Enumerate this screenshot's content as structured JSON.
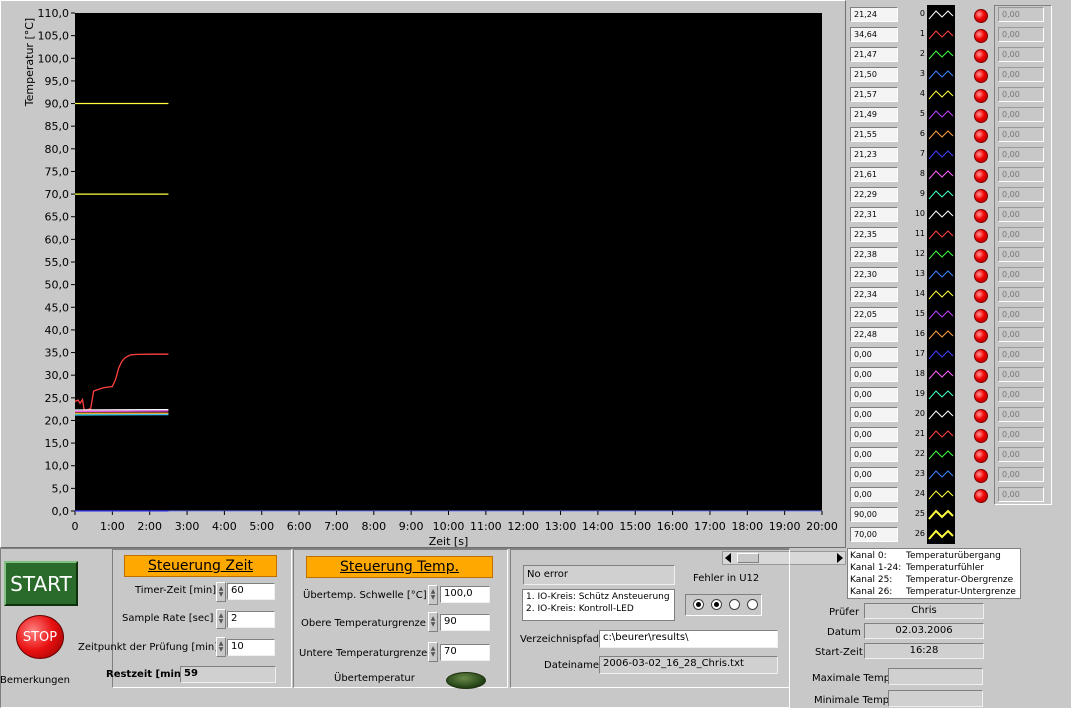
{
  "chart_data": {
    "type": "line",
    "title": "",
    "xlabel": "Zeit [s]",
    "ylabel": "Temperatur [°C]",
    "xlim": [
      0,
      1200
    ],
    "ylim": [
      0,
      110
    ],
    "x_tick_labels": [
      "0",
      "1:00",
      "2:00",
      "3:00",
      "4:00",
      "5:00",
      "6:00",
      "7:00",
      "8:00",
      "9:00",
      "10:00",
      "11:00",
      "12:00",
      "13:00",
      "14:00",
      "15:00",
      "16:00",
      "17:00",
      "18:00",
      "19:00",
      "20:00"
    ],
    "y_tick_labels": [
      "0,0",
      "5,0",
      "10,0",
      "15,0",
      "20,0",
      "25,0",
      "30,0",
      "35,0",
      "40,0",
      "45,0",
      "50,0",
      "55,0",
      "60,0",
      "65,0",
      "70,0",
      "75,0",
      "80,0",
      "85,0",
      "90,0",
      "95,0",
      "100,0",
      "105,0",
      "110,0"
    ],
    "background": "#000000",
    "series": [
      {
        "color": "#ffff40",
        "x": [
          0,
          150
        ],
        "y": [
          90,
          90
        ]
      },
      {
        "color": "#ffff40",
        "x": [
          0,
          150
        ],
        "y": [
          70,
          70
        ]
      },
      {
        "color": "#ff4040",
        "x": [
          0,
          5,
          8,
          12,
          15,
          25,
          30,
          45,
          50,
          60,
          65,
          70,
          75,
          80,
          85,
          90,
          100,
          120,
          150
        ],
        "y": [
          24.2,
          24.5,
          23.8,
          24.6,
          22.2,
          22.6,
          26.5,
          27.2,
          27.3,
          27.5,
          29,
          31.5,
          33,
          33.8,
          34.2,
          34.5,
          34.6,
          34.64,
          34.64
        ]
      },
      {
        "color": "#ffffff",
        "x": [
          0,
          150
        ],
        "y": [
          22.3,
          22.4
        ]
      },
      {
        "color": "#ff60ff",
        "x": [
          0,
          150
        ],
        "y": [
          22.0,
          22.1
        ]
      },
      {
        "color": "#40ff40",
        "x": [
          0,
          150
        ],
        "y": [
          21.5,
          21.5
        ]
      },
      {
        "color": "#40c0ff",
        "x": [
          0,
          150
        ],
        "y": [
          21.2,
          21.3
        ]
      },
      {
        "color": "#ffa040",
        "x": [
          0,
          150
        ],
        "y": [
          21.6,
          21.6
        ]
      },
      {
        "color": "#4040ff",
        "x": [
          0,
          150
        ],
        "y": [
          0,
          0
        ]
      }
    ]
  },
  "channels": {
    "values": [
      "21,24",
      "34,64",
      "21,47",
      "21,50",
      "21,57",
      "21,49",
      "21,55",
      "21,23",
      "21,61",
      "22,29",
      "22,31",
      "22,35",
      "22,38",
      "22,30",
      "22,34",
      "22,05",
      "22,48",
      "0,00",
      "0,00",
      "0,00",
      "0,00",
      "0,00",
      "0,00",
      "0,00",
      "0,00",
      "90,00",
      "70,00"
    ],
    "numbers": [
      "0",
      "1",
      "2",
      "3",
      "4",
      "5",
      "6",
      "7",
      "8",
      "9",
      "10",
      "11",
      "12",
      "13",
      "14",
      "15",
      "16",
      "17",
      "18",
      "19",
      "20",
      "21",
      "22",
      "23",
      "24",
      "25",
      "26"
    ],
    "colors": [
      "#ffffff",
      "#ff4040",
      "#40ff40",
      "#4080ff",
      "#ffff40",
      "#c040ff",
      "#ffa040",
      "#4040ff",
      "#ff60ff",
      "#40ffc0",
      "#ffffff",
      "#ff4040",
      "#40ff40",
      "#4080ff",
      "#ffff40",
      "#c040ff",
      "#ffa040",
      "#4040ff",
      "#ff60ff",
      "#40ffc0",
      "#ffffff",
      "#ff4040",
      "#40ff40",
      "#4080ff",
      "#ffff40",
      "#ffff40",
      "#ffff40"
    ],
    "outputs": [
      "0,00",
      "0,00",
      "0,00",
      "0,00",
      "0,00",
      "0,00",
      "0,00",
      "0,00",
      "0,00",
      "0,00",
      "0,00",
      "0,00",
      "0,00",
      "0,00",
      "0,00",
      "0,00",
      "0,00",
      "0,00",
      "0,00",
      "0,00",
      "0,00",
      "0,00",
      "0,00",
      "0,00",
      "0,00"
    ]
  },
  "legend_box": {
    "lines": [
      {
        "k": "Kanal 0:",
        "v": "Temperaturübergang"
      },
      {
        "k": "Kanal 1-24:",
        "v": "Temperaturfühler"
      },
      {
        "k": "Kanal 25:",
        "v": "Temperatur-Obergrenze"
      },
      {
        "k": "Kanal 26:",
        "v": "Temperatur-Untergrenze"
      }
    ]
  },
  "controls": {
    "start_label": "START",
    "stop_label": "STOP",
    "bemerkungen_label": "Bemerkungen",
    "zeit_header": "Steuerung Zeit",
    "timer_label": "Timer-Zeit [min]",
    "timer_value": "60",
    "sample_label": "Sample Rate [sec]",
    "sample_value": "2",
    "zeitpunkt_label": "Zeitpunkt der Prüfung [min]",
    "zeitpunkt_value": "10",
    "restzeit_label": "Restzeit [min]",
    "restzeit_value": "59",
    "temp_header": "Steuerung Temp.",
    "schwelle_label": "Übertemp. Schwelle [°C]",
    "schwelle_value": "100,0",
    "obere_label": "Obere Temperaturgrenze",
    "obere_value": "90",
    "untere_label": "Untere Temperaturgrenze",
    "untere_value": "70",
    "uebertemp_label": "Übertemperatur"
  },
  "io": {
    "error_text": "No error",
    "list": [
      "1. IO-Kreis: Schütz Ansteuerung",
      "2. IO-Kreis: Kontroll-LED"
    ],
    "fehler_label": "Fehler in U12",
    "path_label": "Verzeichnispfad",
    "path_value": "c:\\beurer\\results\\",
    "file_label": "Dateiname",
    "file_value": "2006-03-02_16_28_Chris.txt"
  },
  "info": {
    "pruefer_label": "Prüfer",
    "pruefer_value": "Chris",
    "datum_label": "Datum",
    "datum_value": "02.03.2006",
    "start_label": "Start-Zeit",
    "start_value": "16:28",
    "max_label": "Maximale Temp.",
    "max_value": "",
    "min_label": "Minimale Temp.",
    "min_value": ""
  }
}
